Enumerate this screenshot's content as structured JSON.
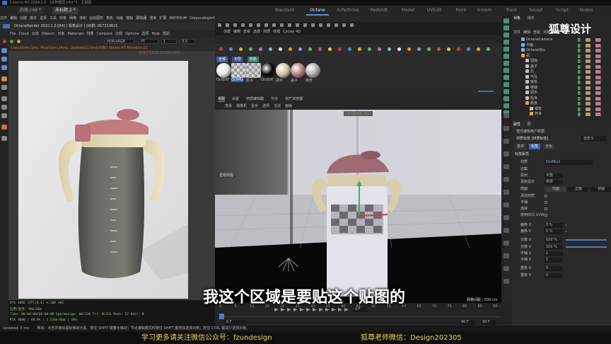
{
  "titlebar": {
    "text": "Cinema 4D 2024.2.0 - [水杯模型.c4d *] - 主视图"
  },
  "doc_tabs": [
    {
      "label": "奶瓶.c4d *"
    },
    {
      "label": "未标题 2 *"
    }
  ],
  "layout_tabs": [
    {
      "label": "Standard",
      "active": false
    },
    {
      "label": "Octane",
      "active": true
    },
    {
      "label": "X-Particles",
      "active": false
    },
    {
      "label": "Redshift",
      "active": false
    },
    {
      "label": "Model",
      "active": false
    },
    {
      "label": "UVEdit",
      "active": false
    },
    {
      "label": "Paint",
      "active": false
    },
    {
      "label": "Groom",
      "active": false
    },
    {
      "label": "Track",
      "active": false
    },
    {
      "label": "Sculpt",
      "active": false
    },
    {
      "label": "Script",
      "active": false
    },
    {
      "label": "Nodes",
      "active": false
    }
  ],
  "main_menu": [
    "文件",
    "编辑",
    "创建",
    "模式",
    "选择",
    "工具",
    "样条",
    "网格",
    "体积",
    "运动图形",
    "角色",
    "动画",
    "模拟",
    "跟踪器",
    "渲染",
    "扩展",
    "INSYDIUM",
    "Greyscalegorilla",
    "Octane",
    "窗口",
    "帮助"
  ],
  "octane_render": {
    "title": "OctaneRender 2022.1.2-[R4] | 狐尊设计 | QQ群: 857313621"
  },
  "octane_menu": [
    "File",
    "Cloud",
    "云端",
    "Objects",
    "对象",
    "Materials",
    "材质",
    "Compare",
    "比较",
    "Options",
    "选项",
    "Help",
    "帮助"
  ],
  "render_toolbar": {
    "color_space": "HDR/sRGB",
    "mode": "PT",
    "value1": "1",
    "value2": "0.9",
    "resolution": "1080*1620 ZOOM:69%"
  },
  "render_status": "CheckOms:1ms. MeshGen:24ms. Update[G]:0ms[对象1 Nodes:47 Movable:11",
  "render_stats": [
    "RTX 3080 (RT)(8.6)     %:100    %93",
    "已用/显存: 96k/6Gb",
    "Time: 00:00:00/00:00:00    Spp/maxspp: 66/128  Tri: 0/22k  Mesh: 12  Hair: 0",
    "RTX 3080  |  98.9%  |  1.52Gb/6Gb  |  GPU"
  ],
  "material_menu": [
    "创建",
    "编辑",
    "查看",
    "选择",
    "材质",
    "纹理",
    "Cycles 4D"
  ],
  "material_tabs": [
    {
      "label": "全部"
    },
    {
      "label": "无层"
    },
    {
      "label": "奶瓶"
    }
  ],
  "materials": [
    {
      "label": "OctDiff",
      "color": "#e8e8e8"
    },
    {
      "label": "OctMix",
      "color": "#8c8c8c"
    },
    {
      "label": "瓶子",
      "color": "#b9b9b9"
    },
    {
      "label": "OctDiff",
      "color": "#0a0a0a"
    },
    {
      "label": "把手",
      "color": "#d4c6a4"
    },
    {
      "label": "盖子",
      "color": "#b97f88"
    },
    {
      "label": "吸管",
      "color": "#b0b0b0"
    }
  ],
  "viewport_tabs": [
    "视图",
    "设置",
    "材质编辑器",
    "节点",
    "资产浏览器"
  ],
  "viewport_menu": [
    "查看",
    "摄像机",
    "显示",
    "选项",
    "过滤",
    "面板"
  ],
  "viewport": {
    "label": "透视视图",
    "camera_label": "CBS摄像机 默认",
    "grid_spacing": "网格间距 : 500 cm"
  },
  "timeline": {
    "frame_current": "0 F",
    "frame_start": "0 F",
    "frame_end": "90 F",
    "frame_end2": "90 F",
    "ticks": [
      "0",
      "5",
      "10",
      "15",
      "20",
      "25",
      "30",
      "35",
      "40",
      "45",
      "50",
      "55",
      "60",
      "65",
      "70",
      "75",
      "80",
      "85",
      "90"
    ]
  },
  "objects_panel": {
    "tabs": [
      "对象",
      "场次"
    ],
    "menu": [
      "文件",
      "编辑",
      "查看",
      "对象",
      "标签",
      "书签"
    ]
  },
  "objects": [
    {
      "name": "OctaneCamera",
      "level": 0,
      "color": "#7fb2f0"
    },
    {
      "name": "平面",
      "level": 0,
      "color": "#7fb2f0"
    },
    {
      "name": "OctaneSky",
      "level": 0,
      "color": "#7fb2f0"
    },
    {
      "name": "瓶",
      "level": 0,
      "color": "#e8a64a"
    },
    {
      "name": "扭曲",
      "level": 1,
      "color": "#c0c0c0"
    },
    {
      "name": "盖子",
      "level": 1,
      "color": "#c0c0c0"
    },
    {
      "name": "孔",
      "level": 1,
      "color": "#c0c0c0"
    },
    {
      "name": "气孔",
      "level": 1,
      "color": "#c0c0c0"
    },
    {
      "name": "吸管",
      "level": 1,
      "color": "#c0c0c0"
    },
    {
      "name": "链接",
      "level": 1,
      "color": "#c0c0c0"
    },
    {
      "name": "把手",
      "level": 1,
      "color": "#c0c0c0"
    },
    {
      "name": "瓶身",
      "level": 1,
      "color": "#c0c0c0"
    },
    {
      "name": "瓶身",
      "level": 1,
      "color": "#e8a64a"
    },
    {
      "name": "细管",
      "level": 2,
      "color": "#c0c0c0"
    },
    {
      "name": "杯身",
      "level": 2,
      "color": "#e8a64a"
    }
  ],
  "attributes_panel": {
    "tabs": [
      "属性",
      "层"
    ],
    "menu": [
      "模式",
      "编辑",
      "用户数据"
    ],
    "title": "材质标签 [材质标签]",
    "preset": "自定义",
    "subtabs": [
      "基本",
      "标签",
      "坐标"
    ],
    "section": "标签属性",
    "rows": [
      {
        "label": "材质",
        "value": "OctMix1"
      },
      {
        "label": "选集",
        "value": ""
      },
      {
        "label": "投射",
        "value": "平直"
      },
      {
        "label": "投射显示",
        "value": "简单"
      },
      {
        "label": "侧面",
        "value": ""
      },
      {
        "label": "添加材质",
        "value": ""
      },
      {
        "label": "平铺",
        "value": ""
      },
      {
        "label": "连续",
        "value": ""
      },
      {
        "label": "使用凹凸 UVW",
        "value": ""
      },
      {
        "label": "偏移 U",
        "value": "0 %"
      },
      {
        "label": "偏移 V",
        "value": "0 %"
      },
      {
        "label": "长度 U",
        "value": "100 %"
      },
      {
        "label": "长度 V",
        "value": "100 %"
      },
      {
        "label": "平铺 U",
        "value": "1"
      },
      {
        "label": "平铺 V",
        "value": "1"
      },
      {
        "label": "重复 U",
        "value": "0"
      },
      {
        "label": "重复 V",
        "value": "0"
      }
    ],
    "side_options": [
      "双面",
      "正面",
      "背面"
    ]
  },
  "statusbar": {
    "left": "Updated: 0 ms",
    "text": "移动：点击并拖动鼠标移动元素。按住 SHIFT 键量化移动；节点编辑模式时按住 SHIFT 键增加选择对象；按住 CTRL 键减少选择对象。"
  },
  "subtitle": "我这个区域是要贴这个贴图的",
  "promo": {
    "left": "学习更多请关注微信公众号：fzundesign",
    "right": "狐尊老师微信：Design202305"
  },
  "logo": "狐尊设计"
}
